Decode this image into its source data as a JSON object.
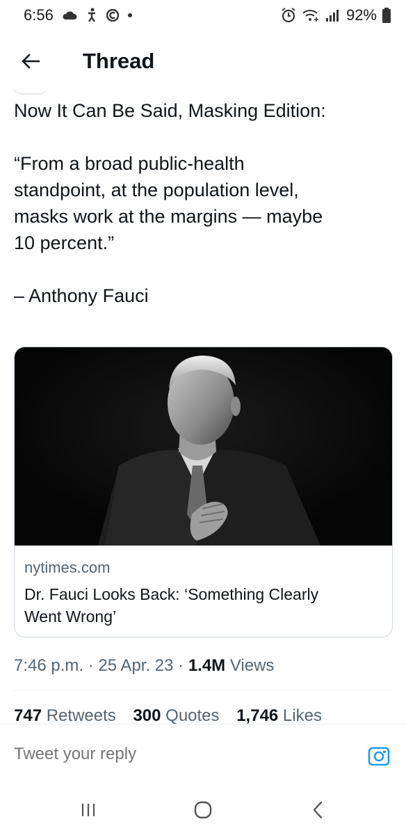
{
  "status_bar": {
    "time": "6:56",
    "battery": "92%",
    "icons": [
      "cloud-icon",
      "accessibility-icon",
      "c-icon",
      "dot-icon",
      "alarm-icon",
      "wifi-icon",
      "signal-icon",
      "battery-icon"
    ]
  },
  "header": {
    "title": "Thread",
    "back_icon": "arrow-left-icon"
  },
  "tweet": {
    "line1": "Now It Can Be Said, Masking Edition:",
    "quote_line1": "“From a broad public-health",
    "quote_line2": "standpoint, at the population level,",
    "quote_line3": "masks work at the margins — maybe",
    "quote_line4": "10 percent.”",
    "attribution": "– Anthony Fauci"
  },
  "card": {
    "domain": "nytimes.com",
    "title_line1": "Dr. Fauci Looks Back: ‘Something Clearly",
    "title_line2": "Went Wrong’"
  },
  "meta": {
    "time": "7:46 p.m.",
    "sep": " · ",
    "date": "25 Apr. 23",
    "views_count": "1.4M",
    "views_label": " Views"
  },
  "stats": {
    "retweets_count": "747",
    "retweets_label": " Retweets",
    "quotes_count": "300",
    "quotes_label": " Quotes",
    "likes_count": "1,746",
    "likes_label": " Likes"
  },
  "reply": {
    "placeholder": "Tweet your reply",
    "camera_icon": "camera-icon"
  },
  "nav": {
    "icons": [
      "recents-icon",
      "home-icon",
      "back-icon"
    ]
  },
  "colors": {
    "text": "#0f1419",
    "secondary": "#536471",
    "accent": "#1d9bf0",
    "border": "#cfd9de"
  }
}
